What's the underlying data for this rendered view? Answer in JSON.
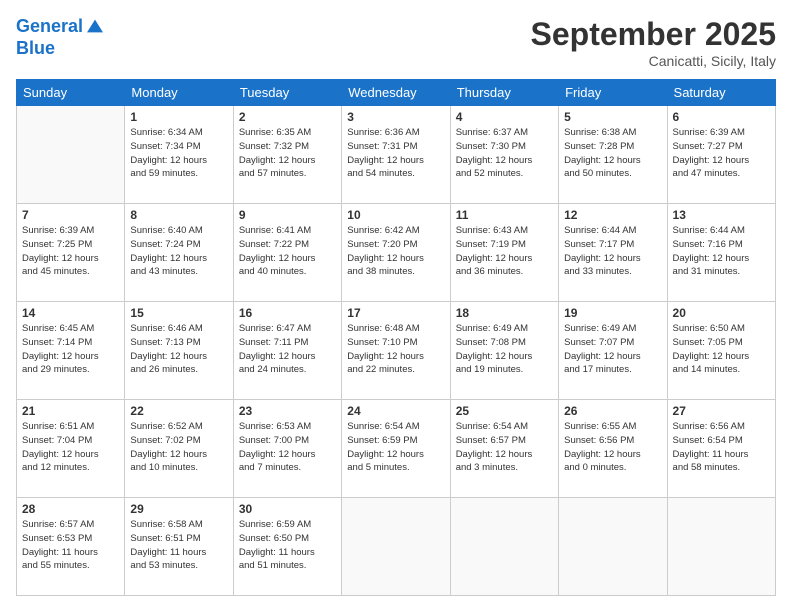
{
  "header": {
    "logo_line1": "General",
    "logo_line2": "Blue",
    "month": "September 2025",
    "location": "Canicatti, Sicily, Italy"
  },
  "days_of_week": [
    "Sunday",
    "Monday",
    "Tuesday",
    "Wednesday",
    "Thursday",
    "Friday",
    "Saturday"
  ],
  "weeks": [
    [
      {
        "day": "",
        "info": ""
      },
      {
        "day": "1",
        "info": "Sunrise: 6:34 AM\nSunset: 7:34 PM\nDaylight: 12 hours\nand 59 minutes."
      },
      {
        "day": "2",
        "info": "Sunrise: 6:35 AM\nSunset: 7:32 PM\nDaylight: 12 hours\nand 57 minutes."
      },
      {
        "day": "3",
        "info": "Sunrise: 6:36 AM\nSunset: 7:31 PM\nDaylight: 12 hours\nand 54 minutes."
      },
      {
        "day": "4",
        "info": "Sunrise: 6:37 AM\nSunset: 7:30 PM\nDaylight: 12 hours\nand 52 minutes."
      },
      {
        "day": "5",
        "info": "Sunrise: 6:38 AM\nSunset: 7:28 PM\nDaylight: 12 hours\nand 50 minutes."
      },
      {
        "day": "6",
        "info": "Sunrise: 6:39 AM\nSunset: 7:27 PM\nDaylight: 12 hours\nand 47 minutes."
      }
    ],
    [
      {
        "day": "7",
        "info": "Sunrise: 6:39 AM\nSunset: 7:25 PM\nDaylight: 12 hours\nand 45 minutes."
      },
      {
        "day": "8",
        "info": "Sunrise: 6:40 AM\nSunset: 7:24 PM\nDaylight: 12 hours\nand 43 minutes."
      },
      {
        "day": "9",
        "info": "Sunrise: 6:41 AM\nSunset: 7:22 PM\nDaylight: 12 hours\nand 40 minutes."
      },
      {
        "day": "10",
        "info": "Sunrise: 6:42 AM\nSunset: 7:20 PM\nDaylight: 12 hours\nand 38 minutes."
      },
      {
        "day": "11",
        "info": "Sunrise: 6:43 AM\nSunset: 7:19 PM\nDaylight: 12 hours\nand 36 minutes."
      },
      {
        "day": "12",
        "info": "Sunrise: 6:44 AM\nSunset: 7:17 PM\nDaylight: 12 hours\nand 33 minutes."
      },
      {
        "day": "13",
        "info": "Sunrise: 6:44 AM\nSunset: 7:16 PM\nDaylight: 12 hours\nand 31 minutes."
      }
    ],
    [
      {
        "day": "14",
        "info": "Sunrise: 6:45 AM\nSunset: 7:14 PM\nDaylight: 12 hours\nand 29 minutes."
      },
      {
        "day": "15",
        "info": "Sunrise: 6:46 AM\nSunset: 7:13 PM\nDaylight: 12 hours\nand 26 minutes."
      },
      {
        "day": "16",
        "info": "Sunrise: 6:47 AM\nSunset: 7:11 PM\nDaylight: 12 hours\nand 24 minutes."
      },
      {
        "day": "17",
        "info": "Sunrise: 6:48 AM\nSunset: 7:10 PM\nDaylight: 12 hours\nand 22 minutes."
      },
      {
        "day": "18",
        "info": "Sunrise: 6:49 AM\nSunset: 7:08 PM\nDaylight: 12 hours\nand 19 minutes."
      },
      {
        "day": "19",
        "info": "Sunrise: 6:49 AM\nSunset: 7:07 PM\nDaylight: 12 hours\nand 17 minutes."
      },
      {
        "day": "20",
        "info": "Sunrise: 6:50 AM\nSunset: 7:05 PM\nDaylight: 12 hours\nand 14 minutes."
      }
    ],
    [
      {
        "day": "21",
        "info": "Sunrise: 6:51 AM\nSunset: 7:04 PM\nDaylight: 12 hours\nand 12 minutes."
      },
      {
        "day": "22",
        "info": "Sunrise: 6:52 AM\nSunset: 7:02 PM\nDaylight: 12 hours\nand 10 minutes."
      },
      {
        "day": "23",
        "info": "Sunrise: 6:53 AM\nSunset: 7:00 PM\nDaylight: 12 hours\nand 7 minutes."
      },
      {
        "day": "24",
        "info": "Sunrise: 6:54 AM\nSunset: 6:59 PM\nDaylight: 12 hours\nand 5 minutes."
      },
      {
        "day": "25",
        "info": "Sunrise: 6:54 AM\nSunset: 6:57 PM\nDaylight: 12 hours\nand 3 minutes."
      },
      {
        "day": "26",
        "info": "Sunrise: 6:55 AM\nSunset: 6:56 PM\nDaylight: 12 hours\nand 0 minutes."
      },
      {
        "day": "27",
        "info": "Sunrise: 6:56 AM\nSunset: 6:54 PM\nDaylight: 11 hours\nand 58 minutes."
      }
    ],
    [
      {
        "day": "28",
        "info": "Sunrise: 6:57 AM\nSunset: 6:53 PM\nDaylight: 11 hours\nand 55 minutes."
      },
      {
        "day": "29",
        "info": "Sunrise: 6:58 AM\nSunset: 6:51 PM\nDaylight: 11 hours\nand 53 minutes."
      },
      {
        "day": "30",
        "info": "Sunrise: 6:59 AM\nSunset: 6:50 PM\nDaylight: 11 hours\nand 51 minutes."
      },
      {
        "day": "",
        "info": ""
      },
      {
        "day": "",
        "info": ""
      },
      {
        "day": "",
        "info": ""
      },
      {
        "day": "",
        "info": ""
      }
    ]
  ]
}
